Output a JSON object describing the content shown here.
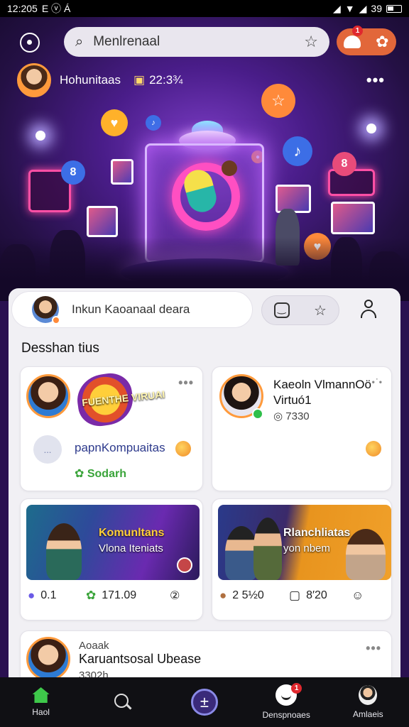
{
  "status_bar": {
    "time": "12:205",
    "left_icons": "E ⓥ Á",
    "battery_text": "39"
  },
  "header": {
    "search_placeholder": "Menlrenaal",
    "notification_count": "1"
  },
  "user": {
    "name": "Hohunitaas",
    "ticket_value": "22:3¾"
  },
  "composer": {
    "placeholder": "Inkun Kaoanaal deara"
  },
  "feed": {
    "section_title": "Desshan tius",
    "card1": {
      "logo_text": "FUENTHE VIRUAI",
      "link_text": "papnKompuaitas",
      "status": "Sodarh",
      "circle_label": "..."
    },
    "card2": {
      "title_line1": "Kaeoln VlmannOö",
      "title_line2": "Virtuó1",
      "meta": "7330"
    },
    "card3": {
      "media_title": "Komunltans",
      "media_sub": "Vlona Iteniats",
      "stat1": "0.1",
      "stat2": "171.09",
      "stat3": "②"
    },
    "card4": {
      "media_title": "Rlanchliatas",
      "media_sub": "yon nbem",
      "stat1": "2 5½0",
      "stat2": "8′20"
    },
    "card5": {
      "author": "Aoaak",
      "title": "Karuantsosal Ubease",
      "meta": "3302h"
    }
  },
  "bottom_nav": {
    "items": [
      {
        "label": "Haol",
        "icon": "home-icon"
      },
      {
        "label": "",
        "icon": "search-icon"
      },
      {
        "label": "",
        "icon": "add-icon"
      },
      {
        "label": "Denspnoaes",
        "icon": "chat-icon"
      },
      {
        "label": "Amlaeis",
        "icon": "profile-icon"
      }
    ],
    "chat_badge": "1"
  },
  "colors": {
    "accent_orange": "#e2673a",
    "hero_purple": "#4a1d8a",
    "nav_bg": "#101014",
    "green": "#3ec84a"
  }
}
